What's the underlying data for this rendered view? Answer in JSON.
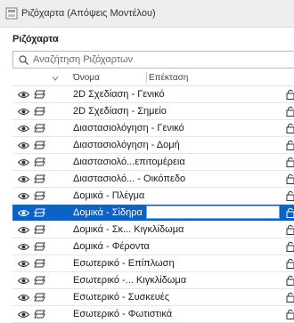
{
  "window": {
    "title": "Ριζόχαρτα (Απόψεις Μοντέλου)"
  },
  "panel": {
    "header": "Ριζόχαρτα"
  },
  "search": {
    "placeholder": "Αναζήτηση Ριζόχαρτων",
    "value": ""
  },
  "table": {
    "columns": {
      "name": "Όνομα",
      "extension": "Επέκταση"
    },
    "rows": [
      {
        "name": "2D Σχεδίαση - Γενικό",
        "selected": false
      },
      {
        "name": "2D Σχεδίαση - Σημείο",
        "selected": false
      },
      {
        "name": "Διαστασιολόγηση - Γενικό",
        "selected": false
      },
      {
        "name": "Διαστασιολόγηση - Δομή",
        "selected": false
      },
      {
        "name": "Διαστασιολό...επιτομέρεια",
        "selected": false
      },
      {
        "name": "Διαστασιολό... - Οικόπεδο",
        "selected": false
      },
      {
        "name": "Δομικά - Πλέγμα",
        "selected": false
      },
      {
        "name": "Δομικά - Σίδηρα",
        "selected": true
      },
      {
        "name": "Δομικά - Σκ... Κιγκλίδωμα",
        "selected": false
      },
      {
        "name": "Δομικά - Φέροντα",
        "selected": false
      },
      {
        "name": "Εσωτερικό - Επίπλωση",
        "selected": false
      },
      {
        "name": "Εσωτερικό -... Κιγκλίδωμα",
        "selected": false
      },
      {
        "name": "Εσωτερικό - Συσκευές",
        "selected": false
      },
      {
        "name": "Εσωτερικό - Φωτιστικά",
        "selected": false
      }
    ]
  },
  "colors": {
    "selection": "#0a63c5",
    "title_bar": "#eeeeee"
  }
}
